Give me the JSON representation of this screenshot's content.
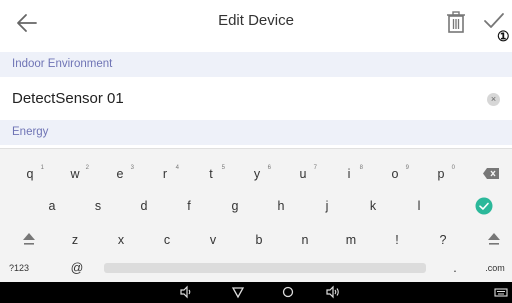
{
  "header": {
    "title": "Edit Device",
    "back_icon": "arrow-left-icon",
    "delete_icon": "trash-icon",
    "save_icon": "checkmark-icon",
    "callout": "①"
  },
  "sections": {
    "group_label": "Indoor Environment",
    "next_label": "Energy"
  },
  "device": {
    "name_value": "DetectSensor 01",
    "clear_icon": "clear-x-icon",
    "clear_glyph": "×"
  },
  "keyboard": {
    "row1": [
      {
        "key": "q",
        "hint": "1"
      },
      {
        "key": "w",
        "hint": "2"
      },
      {
        "key": "e",
        "hint": "3"
      },
      {
        "key": "r",
        "hint": "4"
      },
      {
        "key": "t",
        "hint": "5"
      },
      {
        "key": "y",
        "hint": "6"
      },
      {
        "key": "u",
        "hint": "7"
      },
      {
        "key": "i",
        "hint": "8"
      },
      {
        "key": "o",
        "hint": "9"
      },
      {
        "key": "p",
        "hint": "0"
      }
    ],
    "row2": [
      "a",
      "s",
      "d",
      "f",
      "g",
      "h",
      "j",
      "k",
      "l"
    ],
    "row3": [
      "z",
      "x",
      "c",
      "v",
      "b",
      "n",
      "m",
      "!",
      "?"
    ],
    "symbols_key": "?123",
    "at_key": "@",
    "period_key": ".",
    "dotcom_key": ".com",
    "backspace_icon": "backspace-icon",
    "enter_icon": "done-check-icon",
    "shift_icon": "shift-arrow-icon"
  },
  "colors": {
    "accent_text": "#6f74b5",
    "section_bg": "#eef1f9",
    "done_key": "#2bb89a"
  }
}
